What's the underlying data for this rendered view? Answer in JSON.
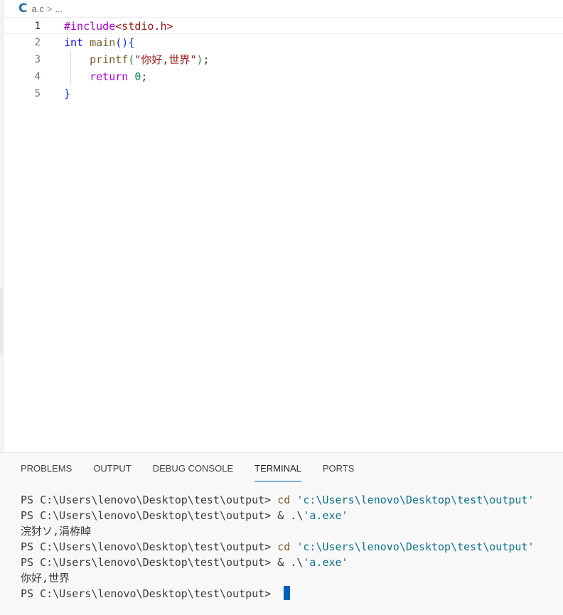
{
  "breadcrumb": {
    "icon": "c-file-icon",
    "icon_glyph": "C",
    "file": "a.c",
    "separator": ">",
    "more": "..."
  },
  "editor": {
    "lines": [
      {
        "num": "1",
        "tokens": [
          {
            "t": "#include",
            "c": "kw-pre"
          },
          {
            "t": "<stdio.h>",
            "c": "inc"
          }
        ]
      },
      {
        "num": "2",
        "tokens": [
          {
            "t": "int",
            "c": "kw"
          },
          {
            "t": " ",
            "c": "punc"
          },
          {
            "t": "main",
            "c": "fn"
          },
          {
            "t": "()",
            "c": "br1"
          },
          {
            "t": "{",
            "c": "br1"
          }
        ]
      },
      {
        "num": "3",
        "tokens": [
          {
            "t": "    ",
            "c": "punc"
          },
          {
            "t": "printf",
            "c": "fn"
          },
          {
            "t": "(",
            "c": "br2"
          },
          {
            "t": "\"你好,世界\"",
            "c": "str"
          },
          {
            "t": ")",
            "c": "br2"
          },
          {
            "t": ";",
            "c": "punc"
          }
        ]
      },
      {
        "num": "4",
        "tokens": [
          {
            "t": "    ",
            "c": "punc"
          },
          {
            "t": "return",
            "c": "kw-pre"
          },
          {
            "t": " ",
            "c": "punc"
          },
          {
            "t": "0",
            "c": "num"
          },
          {
            "t": ";",
            "c": "punc"
          }
        ]
      },
      {
        "num": "5",
        "tokens": [
          {
            "t": "}",
            "c": "br1"
          }
        ]
      }
    ]
  },
  "panel": {
    "tabs": [
      "PROBLEMS",
      "OUTPUT",
      "DEBUG CONSOLE",
      "TERMINAL",
      "PORTS"
    ],
    "active_tab": "TERMINAL"
  },
  "terminal": {
    "lines": [
      {
        "prompt": "PS C:\\Users\\lenovo\\Desktop\\test\\output> ",
        "cmd": "cd",
        "arg": " ",
        "str": "'c:\\Users\\lenovo\\Desktop\\test\\output'"
      },
      {
        "prompt": "PS C:\\Users\\lenovo\\Desktop\\test\\output> ",
        "cmd": "",
        "arg": "& .\\",
        "str": "'a.exe'"
      },
      {
        "prompt": "",
        "cmd": "",
        "arg": "",
        "str": "",
        "output": "浣犲ソ,涓栫晫"
      },
      {
        "prompt": "PS C:\\Users\\lenovo\\Desktop\\test\\output> ",
        "cmd": "cd",
        "arg": " ",
        "str": "'c:\\Users\\lenovo\\Desktop\\test\\output'"
      },
      {
        "prompt": "PS C:\\Users\\lenovo\\Desktop\\test\\output> ",
        "cmd": "",
        "arg": "& .\\",
        "str": "'a.exe'"
      },
      {
        "prompt": "",
        "cmd": "",
        "arg": "",
        "str": "",
        "output": "你好,世界"
      },
      {
        "prompt": "PS C:\\Users\\lenovo\\Desktop\\test\\output> ",
        "cmd": "",
        "arg": "",
        "str": "",
        "cursor": true
      }
    ]
  },
  "colors": {
    "accent": "#005fb8",
    "c_icon": "#1f6fa8"
  }
}
